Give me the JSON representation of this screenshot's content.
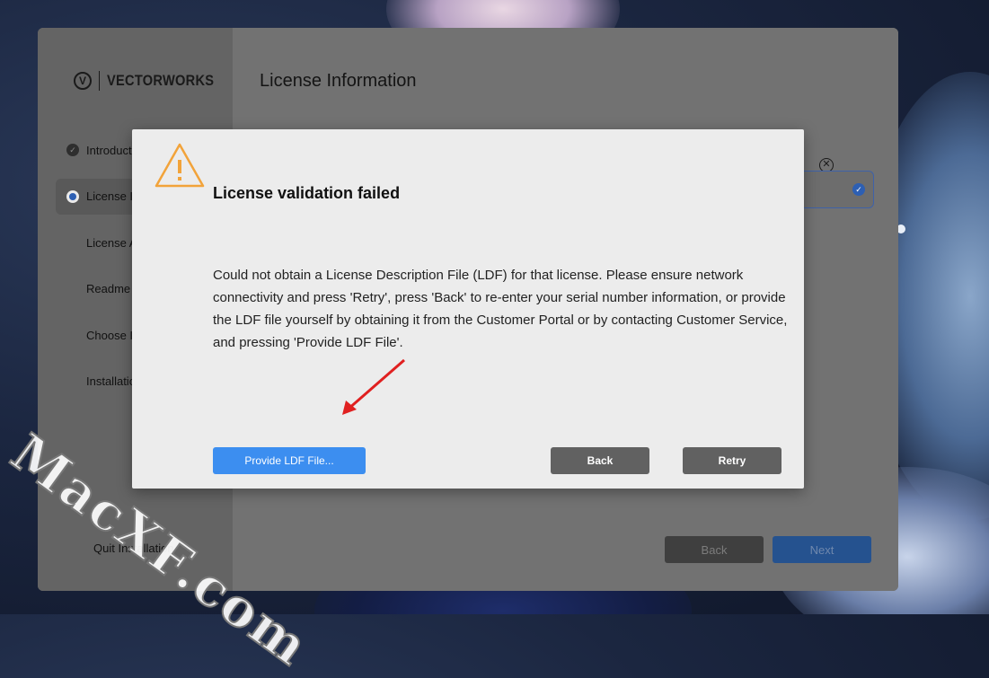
{
  "installer": {
    "logo_text": "VECTORWORKS",
    "logo_mark": "V",
    "page_title": "License Information",
    "steps": [
      {
        "label": "Introduct",
        "state": "done"
      },
      {
        "label": "License I",
        "state": "current"
      },
      {
        "label": "License A",
        "state": "pending"
      },
      {
        "label": "Readme",
        "state": "pending"
      },
      {
        "label": "Choose I",
        "state": "pending"
      },
      {
        "label": "Installatio",
        "state": "pending"
      }
    ],
    "quit_label": "Quit Installation",
    "back_label": "Back",
    "next_label": "Next"
  },
  "dialog": {
    "icon": "warning-icon",
    "title": "License validation failed",
    "message": "Could not obtain a License Description File (LDF) for that license. Please ensure network connectivity and press 'Retry', press 'Back' to re-enter your serial number information, or provide the LDF file yourself by obtaining it from the Customer Portal or by contacting Customer Service, and pressing 'Provide LDF File'.",
    "provide_ldf_label": "Provide LDF File...",
    "back_label": "Back",
    "retry_label": "Retry"
  },
  "watermark": "MacXF.com",
  "colors": {
    "accent_blue": "#3c8ef0",
    "warning_orange": "#f2a33a",
    "annotation_red": "#e02020"
  }
}
